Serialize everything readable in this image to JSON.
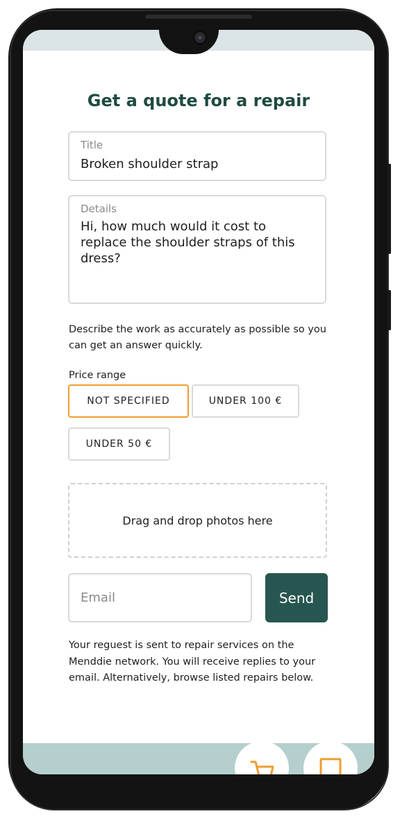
{
  "page": {
    "title": "Get a quote for a repair"
  },
  "form": {
    "title_label": "Title",
    "title_value": "Broken shoulder strap",
    "details_label": "Details",
    "details_value": "Hi, how much would it cost to replace the shoulder straps of this dress?",
    "hint": "Describe the work as accurately as possible so you can get an answer quickly.",
    "price_range_label": "Price range",
    "price_options": [
      "NOT SPECIFIED",
      "UNDER 100 €",
      "UNDER 50 €"
    ],
    "price_selected": "NOT SPECIFIED",
    "dropzone_text": "Drag and drop photos here",
    "email_placeholder": "Email",
    "send_label": "Send",
    "notice": "Your reguest is sent to repair services on the Menddie network. You will receive replies to your email. Alternatively, browse listed repairs below."
  },
  "bottom_nav": {
    "icons": [
      "cart-icon",
      "chat-icon"
    ]
  },
  "colors": {
    "accent_dark": "#1f4a42",
    "send_button": "#275650",
    "selected_chip_border": "#ef9d2d",
    "icon_orange": "#ef9d2d",
    "bottom_bar": "#b4cfcd"
  }
}
